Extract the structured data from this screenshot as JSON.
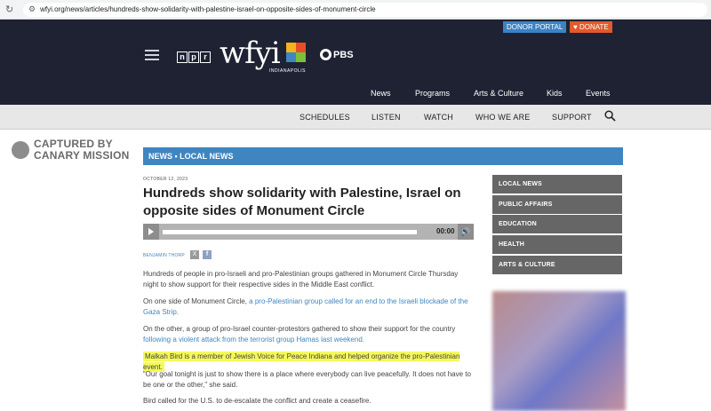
{
  "browser": {
    "url": "wfyi.org/news/articles/hundreds-show-solidarity-with-palestine-israel-on-opposite-sides-of-monument-circle"
  },
  "header": {
    "donor_portal": "DONOR PORTAL",
    "donate": "DONATE",
    "npr_letters": [
      "n",
      "p",
      "r"
    ],
    "wfyi_logo": "wfyi",
    "wfyi_sub": "INDIANAPOLIS",
    "pbs": "PBS",
    "main_nav": [
      "News",
      "Programs",
      "Arts & Culture",
      "Kids",
      "Events"
    ]
  },
  "subnav": {
    "items": [
      "SCHEDULES",
      "LISTEN",
      "WATCH",
      "WHO WE ARE",
      "SUPPORT"
    ]
  },
  "canary": {
    "line1": "CAPTURED BY",
    "line2": "CANARY MISSION"
  },
  "section": {
    "label": "NEWS • LOCAL NEWS"
  },
  "article": {
    "date": "OCTOBER 12, 2023",
    "title": "Hundreds show solidarity with Palestine, Israel on opposite sides of Monument Circle",
    "audio_time": "00:00",
    "author": "BENJAMIN THORP",
    "p1": "Hundreds of people in pro-Israeli and pro-Palestinian groups gathered in Monument Circle Thursday night to show support for their respective sides in the Middle East conflict.",
    "p2_text": "On one side of Monument Circle, ",
    "p2_link": "a pro-Palestinian group called for an end to the Israeli blockade of the Gaza Strip.",
    "p3_text": "On the other, a group of pro-Israel counter-protestors gathered to show their support for the country ",
    "p3_link": "following a violent attack from the terrorist group Hamas last weekend.",
    "p4_highlight": "Malkah Bird is a member of Jewish Voice for Peace Indiana and helped organize the pro-Palestinian event.",
    "p5": "“Our goal tonight is just to show there is a place where everybody can live peacefully. It does not have to be one or the other,” she said.",
    "p6": "Bird called for the U.S. to de-escalate the conflict and create a ceasefire."
  },
  "sidebar": {
    "items": [
      "LOCAL NEWS",
      "PUBLIC AFFAIRS",
      "EDUCATION",
      "HEALTH",
      "ARTS & CULTURE"
    ]
  },
  "colors": {
    "header_bg": "#1e2233",
    "accent_blue": "#3f86c0",
    "donate_orange": "#e05a2b",
    "highlight": "#f5f95b"
  }
}
